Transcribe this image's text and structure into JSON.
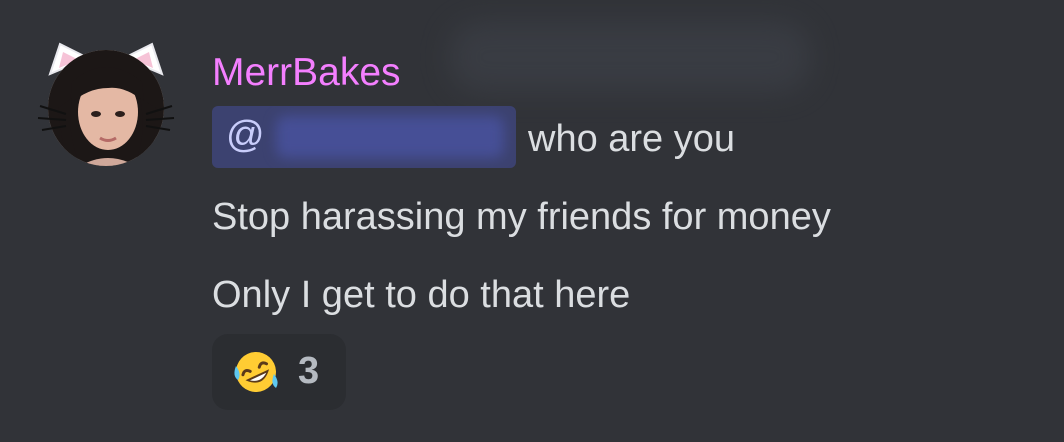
{
  "message": {
    "author": "MerrBakes",
    "author_color": "#f47fff",
    "mention_prefix": "@",
    "lines": [
      "who are you",
      "Stop harassing my friends for money",
      "Only I get to do that here"
    ]
  },
  "reaction": {
    "emoji": "rolling-on-the-floor-laughing-icon",
    "count": "3"
  },
  "colors": {
    "background": "#313338",
    "mention_bg": "#3c4270",
    "reaction_bg": "#2b2d31"
  }
}
